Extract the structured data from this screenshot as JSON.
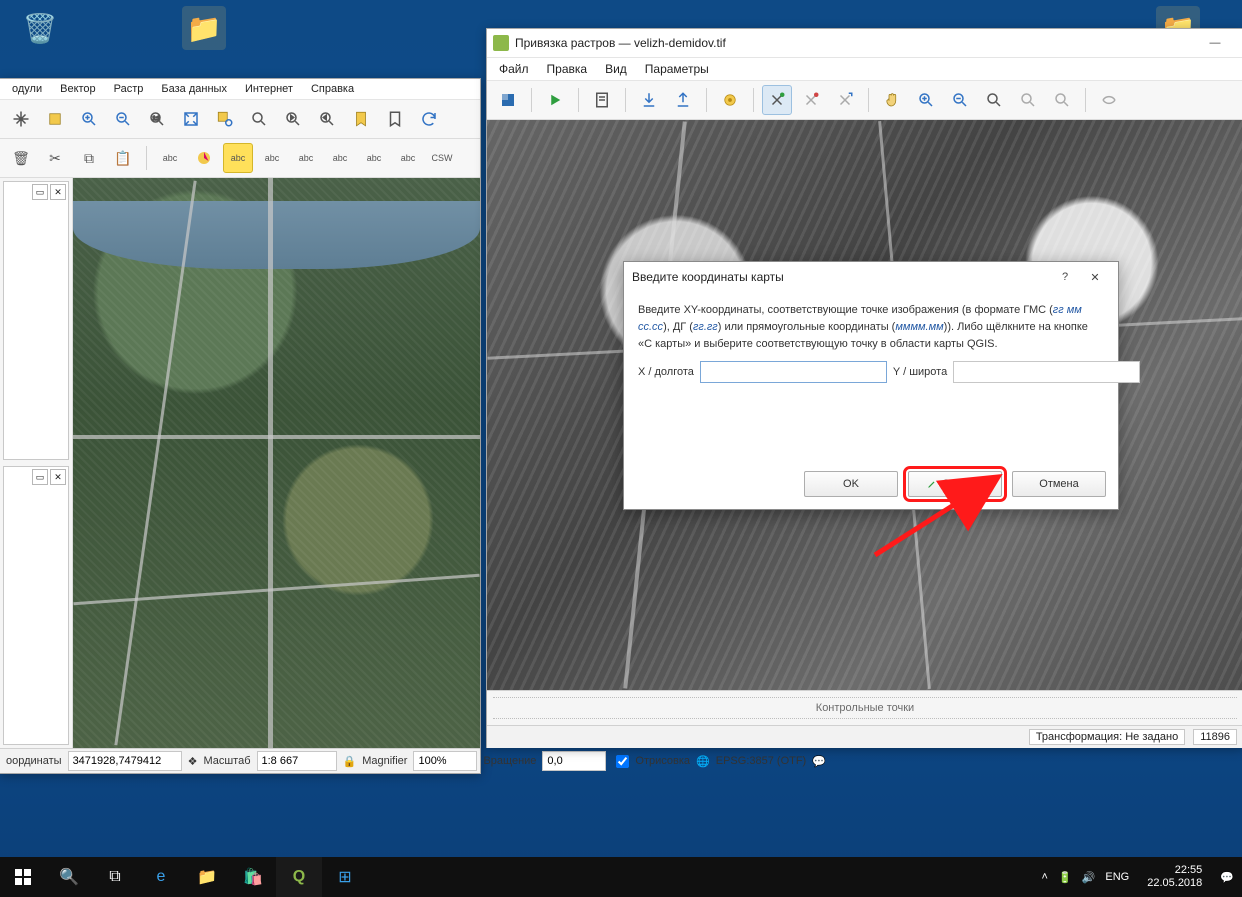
{
  "qgis": {
    "menus": [
      "одули",
      "Вектор",
      "Растр",
      "База данных",
      "Интернет",
      "Справка"
    ],
    "status": {
      "coord_label": "оординаты",
      "coord": "3471928,7479412",
      "scale_label": "Масштаб",
      "scale": "1:8 667",
      "mag_label": "Magnifier",
      "mag": "100%",
      "rot_label": "Вращение",
      "rot": "0,0",
      "render": "Отрисовка",
      "crs": "EPSG:3857 (OTF)"
    }
  },
  "georef": {
    "title": "Привязка растров — velizh-demidov.tif",
    "menus": [
      "Файл",
      "Правка",
      "Вид",
      "Параметры"
    ],
    "gcp_label": "Контрольные точки",
    "transform_label": "Трансформация: Не задано",
    "count": "11896"
  },
  "dialog": {
    "title": "Введите координаты карты",
    "text_a": "Введите XY-координаты, соответствующие точке изображения (в формате ГМС (",
    "fmt1": "гг мм сс.сс",
    "text_b": "), ДГ (",
    "fmt2": "гг.гг",
    "text_c": ") или прямоугольные координаты (",
    "fmt3": "мммм.мм",
    "text_d": ")). Либо щёлкните на кнопке «С карты» и выберите соответствующую точку в области карты QGIS.",
    "x_label": "X / долгота",
    "y_label": "Y / широта",
    "ok": "OK",
    "from_map": "С карты",
    "cancel": "Отмена",
    "help": "?",
    "close": "✕"
  },
  "taskbar": {
    "lang": "ENG",
    "time": "22:55",
    "date": "22.05.2018"
  }
}
